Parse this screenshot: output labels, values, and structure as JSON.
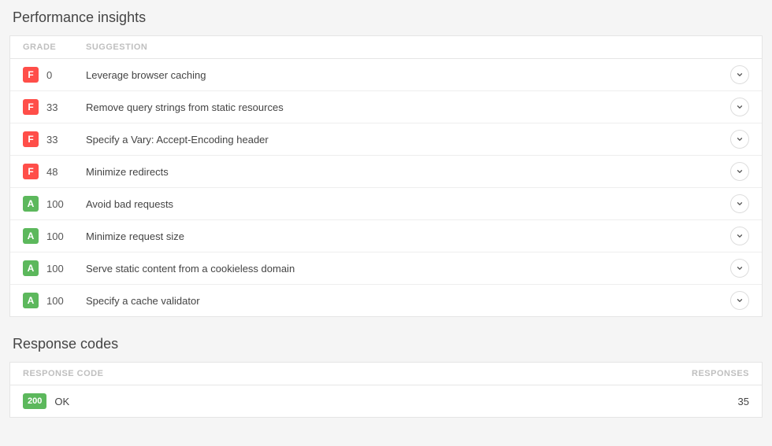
{
  "performance": {
    "title": "Performance insights",
    "headers": {
      "grade": "Grade",
      "suggestion": "Suggestion"
    },
    "rows": [
      {
        "gradeLetter": "F",
        "gradeClass": "f",
        "score": "0",
        "suggestion": "Leverage browser caching"
      },
      {
        "gradeLetter": "F",
        "gradeClass": "f",
        "score": "33",
        "suggestion": "Remove query strings from static resources"
      },
      {
        "gradeLetter": "F",
        "gradeClass": "f",
        "score": "33",
        "suggestion": "Specify a Vary: Accept-Encoding header"
      },
      {
        "gradeLetter": "F",
        "gradeClass": "f",
        "score": "48",
        "suggestion": "Minimize redirects"
      },
      {
        "gradeLetter": "A",
        "gradeClass": "a",
        "score": "100",
        "suggestion": "Avoid bad requests"
      },
      {
        "gradeLetter": "A",
        "gradeClass": "a",
        "score": "100",
        "suggestion": "Minimize request size"
      },
      {
        "gradeLetter": "A",
        "gradeClass": "a",
        "score": "100",
        "suggestion": "Serve static content from a cookieless domain"
      },
      {
        "gradeLetter": "A",
        "gradeClass": "a",
        "score": "100",
        "suggestion": "Specify a cache validator"
      }
    ]
  },
  "response": {
    "title": "Response codes",
    "headers": {
      "code": "Response code",
      "responses": "Responses"
    },
    "rows": [
      {
        "code": "200",
        "codeClass": "200",
        "status": "OK",
        "responses": "35"
      }
    ]
  }
}
